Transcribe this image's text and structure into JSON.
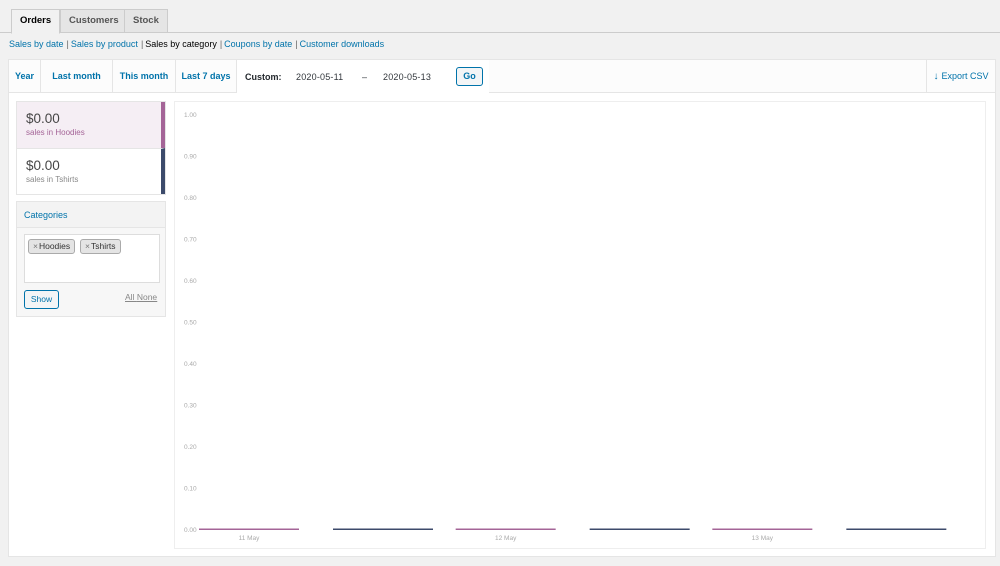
{
  "tabs": [
    {
      "label": "Orders",
      "active": true
    },
    {
      "label": "Customers",
      "active": false
    },
    {
      "label": "Stock",
      "active": false
    }
  ],
  "subnav": [
    {
      "label": "Sales by date",
      "current": false
    },
    {
      "label": "Sales by product",
      "current": false
    },
    {
      "label": "Sales by category",
      "current": true
    },
    {
      "label": "Coupons by date",
      "current": false
    },
    {
      "label": "Customer downloads",
      "current": false
    }
  ],
  "ranges": {
    "year": "Year",
    "last_month": "Last month",
    "this_month": "This month",
    "last_7_days": "Last 7 days",
    "custom_label": "Custom:",
    "date_from": "2020-05-11",
    "dash": "–",
    "date_to": "2020-05-13",
    "go": "Go"
  },
  "export": {
    "icon": "download-arrow-icon",
    "label": "Export CSV"
  },
  "legend": [
    {
      "amount": "$0.00",
      "label": "sales in Hoodies",
      "color": "#a46497",
      "highlighted": true
    },
    {
      "amount": "$0.00",
      "label": "sales in Tshirts",
      "color": "#3c4a6b",
      "highlighted": false
    }
  ],
  "categories": {
    "title": "Categories",
    "selected": [
      "Hoodies",
      "Tshirts"
    ],
    "show": "Show",
    "all": "All",
    "none": "None"
  },
  "colors": {
    "hoodies": "#a46497",
    "tshirts": "#3c4a6b",
    "link": "#0073aa"
  },
  "chart_data": {
    "type": "bar",
    "categories": [
      "11 May",
      "12 May",
      "13 May"
    ],
    "series": [
      {
        "name": "Hoodies",
        "values": [
          0,
          0,
          0
        ],
        "color": "#a46497"
      },
      {
        "name": "Tshirts",
        "values": [
          0,
          0,
          0
        ],
        "color": "#3c4a6b"
      }
    ],
    "ylim": [
      0,
      1
    ],
    "yticks": [
      "0.00",
      "0.10",
      "0.20",
      "0.30",
      "0.40",
      "0.50",
      "0.60",
      "0.70",
      "0.80",
      "0.90",
      "1.00"
    ],
    "grid": false
  }
}
